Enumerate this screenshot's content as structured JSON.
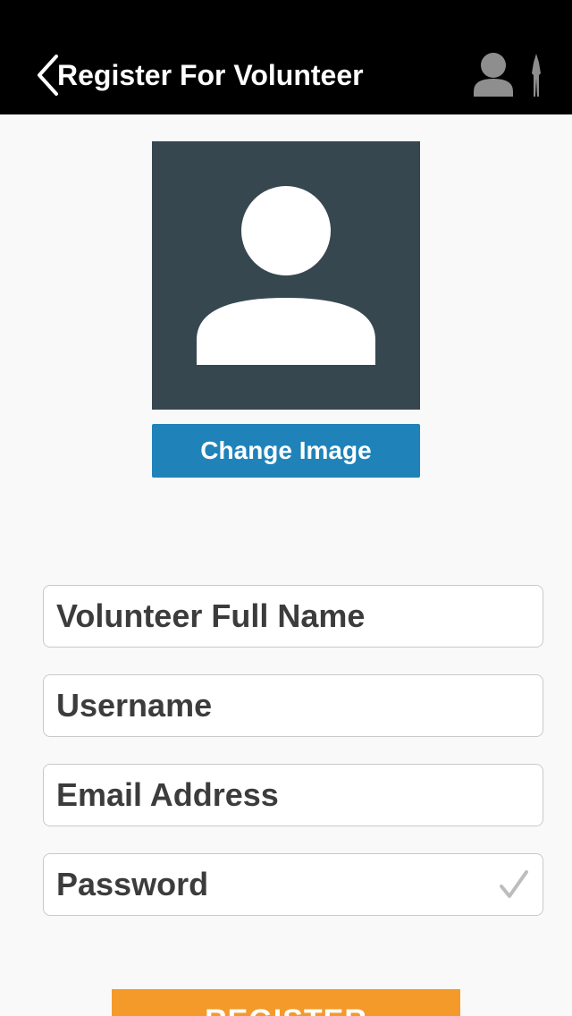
{
  "header": {
    "title": "Register For Volunteer",
    "back_icon": "chevron-left-icon",
    "right_icons": [
      "person-icon",
      "figure-icon"
    ],
    "background": "#000000",
    "text_color": "#ffffff"
  },
  "avatar": {
    "icon": "avatar-placeholder-icon",
    "background": "#37474f"
  },
  "change_image": {
    "label": "Change Image",
    "color": "#1f83ba"
  },
  "form": {
    "full_name": {
      "placeholder": "Volunteer Full Name",
      "value": ""
    },
    "username": {
      "placeholder": "Username",
      "value": ""
    },
    "email": {
      "placeholder": "Email Address",
      "value": ""
    },
    "password": {
      "placeholder": "Password",
      "value": "",
      "status_icon": "checkmark-icon"
    }
  },
  "register": {
    "label": "REGISTER",
    "color": "#f39a2b"
  }
}
